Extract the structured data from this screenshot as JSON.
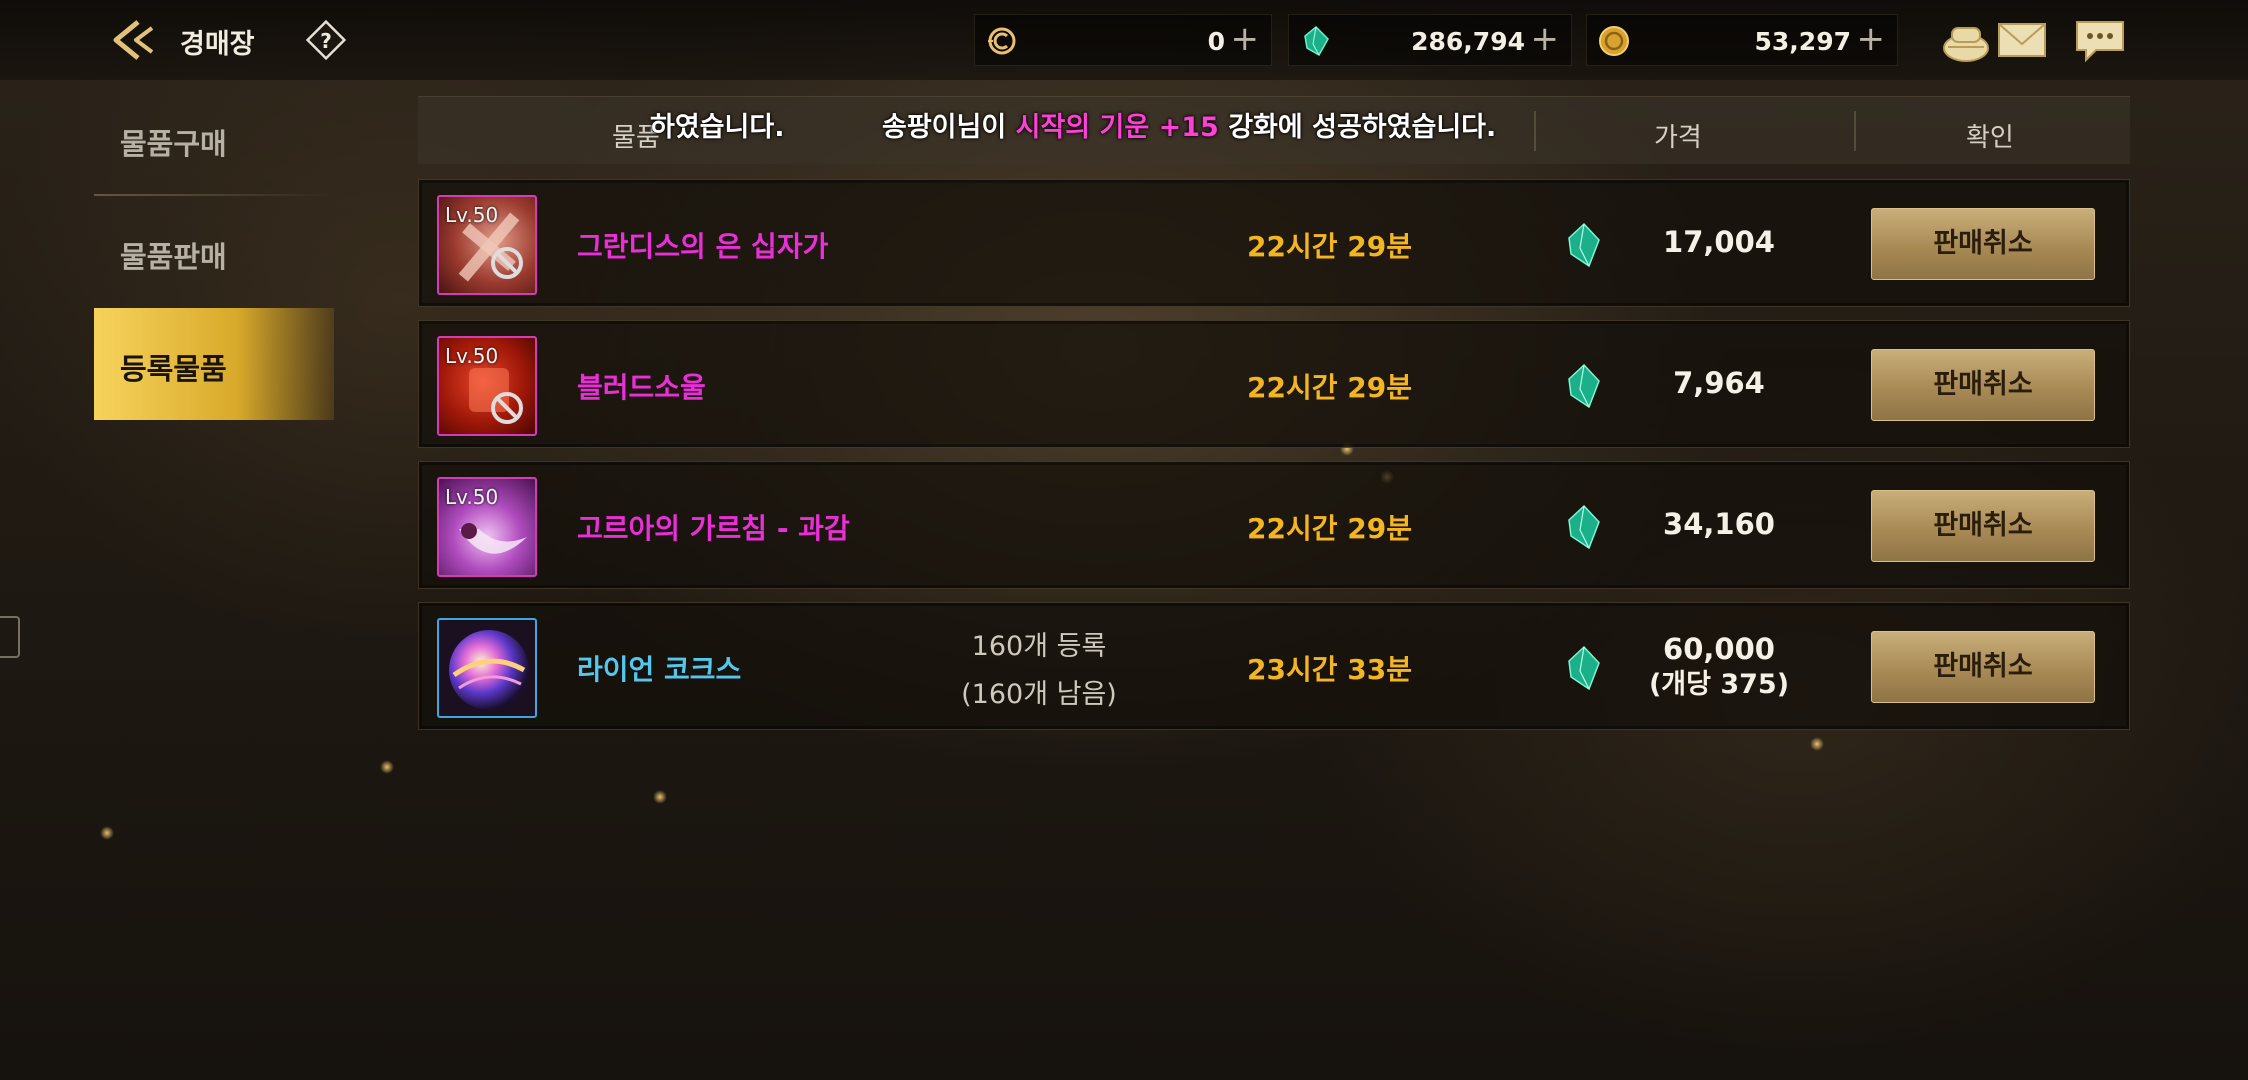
{
  "header": {
    "title": "경매장",
    "back_icon": "back-arrow-icon",
    "help_icon": "help-icon"
  },
  "currencies": [
    {
      "icon": "coin-c-icon",
      "amount": "0"
    },
    {
      "icon": "gem-icon",
      "amount": "286,794"
    },
    {
      "icon": "gold-icon",
      "amount": "53,297"
    }
  ],
  "top_icons": [
    "bag-icon",
    "mail-icon",
    "chat-icon"
  ],
  "sidebar": {
    "items": [
      {
        "label": "물품구매",
        "active": false
      },
      {
        "label": "물품판매",
        "active": false
      },
      {
        "label": "등록물품",
        "active": true
      }
    ]
  },
  "table": {
    "headers": {
      "item": "물품",
      "price": "가격",
      "confirm": "확인"
    },
    "notice_left": "하였습니다.",
    "notice_prefix": "송팡이님이 ",
    "notice_highlight": "시작의 기운 +15",
    "notice_suffix": " 강화에 성공하였습니다."
  },
  "rows": [
    {
      "level": "Lv.50",
      "name": "그란디스의 은 십자가",
      "name_color": "magenta",
      "qty_line1": "",
      "qty_line2": "",
      "time": "22시간 29분",
      "price": "17,004",
      "price_sub": "",
      "button": "판매취소"
    },
    {
      "level": "Lv.50",
      "name": "블러드소울",
      "name_color": "magenta",
      "qty_line1": "",
      "qty_line2": "",
      "time": "22시간 29분",
      "price": "7,964",
      "price_sub": "",
      "button": "판매취소"
    },
    {
      "level": "Lv.50",
      "name": "고르아의 가르침 - 과감",
      "name_color": "magenta",
      "qty_line1": "",
      "qty_line2": "",
      "time": "22시간 29분",
      "price": "34,160",
      "price_sub": "",
      "button": "판매취소"
    },
    {
      "level": "",
      "name": "라이언 코크스",
      "name_color": "cyan",
      "qty_line1": "160개 등록",
      "qty_line2": "(160개 남음)",
      "time": "23시간 33분",
      "price": "60,000",
      "price_sub": "(개당 375)",
      "button": "판매취소"
    }
  ],
  "colors": {
    "accent_gold": "#f4b523",
    "item_magenta": "#ea2fd9",
    "item_cyan": "#55c7ec"
  }
}
